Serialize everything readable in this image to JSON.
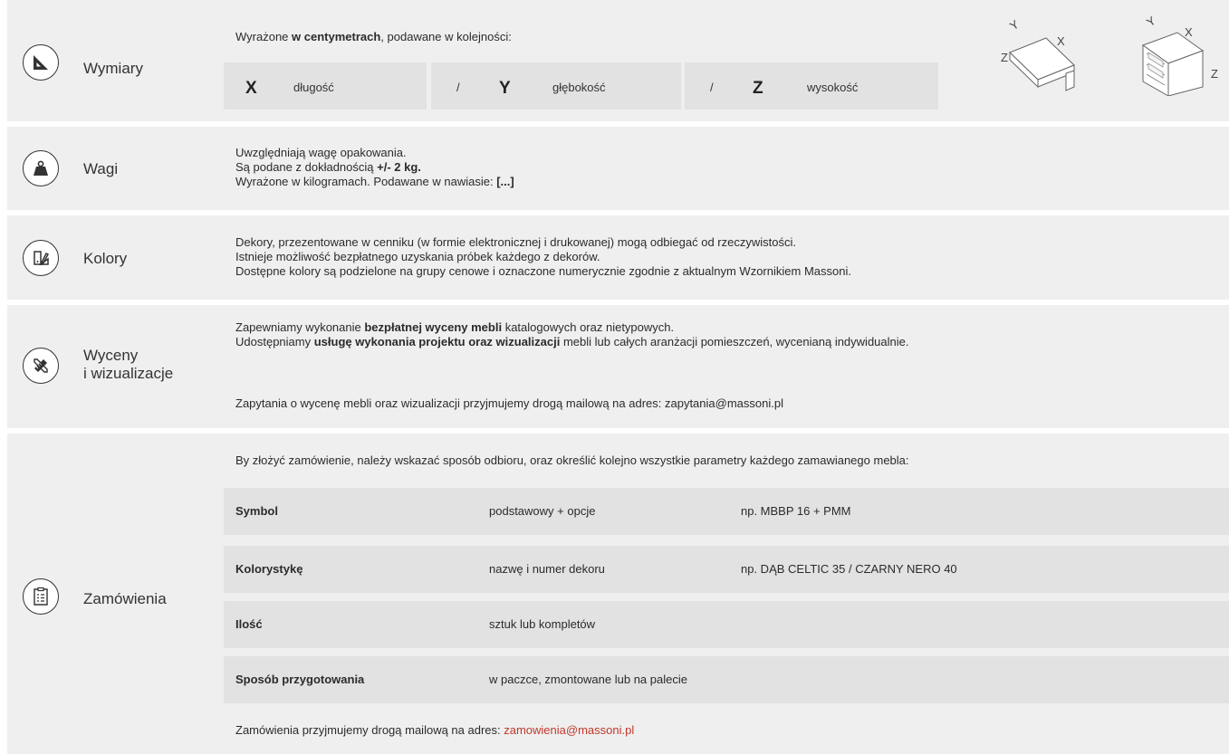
{
  "wymiary": {
    "label": "Wymiary",
    "intro_a": "Wyrażone ",
    "intro_b": "w centymetrach",
    "intro_c": ", podawane w kolejności:",
    "x_axis": "X",
    "x_label": "długość",
    "sep": "/",
    "y_axis": "Y",
    "y_label": "głębokość",
    "z_axis": "Z",
    "z_label": "wysokość",
    "diagram_letters": {
      "x": "X",
      "y": "Y",
      "z": "Z"
    }
  },
  "wagi": {
    "label": "Wagi",
    "line1": "Uwzględniają wagę opakowania.",
    "line2_a": "Są podane z dokładnością ",
    "line2_b": "+/- 2 kg.",
    "line3_a": "Wyrażone w kilogramach. Podawane w nawiasie: ",
    "line3_b": "[...]"
  },
  "kolory": {
    "label": "Kolory",
    "line1": "Dekory, przezentowane w cenniku (w formie elektronicznej i drukowanej) mogą odbiegać od rzeczywistości.",
    "line2": "Istnieje możliwość bezpłatnego uzyskania próbek każdego z dekorów.",
    "line3": "Dostępne kolory są podzielone na grupy cenowe i oznaczone numerycznie zgodnie z aktualnym Wzornikiem Massoni."
  },
  "wyceny": {
    "label1": "Wyceny",
    "label2": "i wizualizacje",
    "line1_a": "Zapewniamy wykonanie ",
    "line1_b": "bezpłatnej wyceny mebli",
    "line1_c": " katalogowych oraz nietypowych.",
    "line2_a": "Udostępniamy ",
    "line2_b": "usługę wykonania projektu oraz wizualizacji",
    "line2_c": " mebli lub całych aranżacji pomieszczeń, wycenianą indywidualnie.",
    "line3": "Zapytania o wycenę mebli oraz wizualizacji przyjmujemy drogą mailową na adres: zapytania@massoni.pl"
  },
  "zamowienia": {
    "label": "Zamówienia",
    "intro": "By złożyć zamówienie, należy wskazać sposób odbioru, oraz określić kolejno wszystkie parametry każdego zamawianego mebla:",
    "rows": [
      {
        "name": "Symbol",
        "desc": "podstawowy + opcje",
        "example": "np. MBBP 16 + PMM"
      },
      {
        "name": "Kolorystykę",
        "desc": "nazwę i numer dekoru",
        "example": "np. DĄB CELTIC 35 / CZARNY NERO 40"
      },
      {
        "name": "Ilość",
        "desc": "sztuk lub kompletów",
        "example": ""
      },
      {
        "name": "Sposób przygotowania",
        "desc": "w paczce, zmontowane lub na palecie",
        "example": ""
      }
    ],
    "footer_a": "Zamówienia przyjmujemy drogą mailową na adres: ",
    "footer_email": "zamowienia@massoni.pl"
  },
  "icons": {
    "wymiary": "set-square-icon",
    "wagi": "weight-icon",
    "kolory": "color-swatch-icon",
    "wyceny": "pencil-ruler-icon",
    "zamowienia": "order-list-icon"
  },
  "colors": {
    "section_bg": "#efefef",
    "inner_box_bg": "#e2e2e2",
    "email_accent": "#c0392b"
  }
}
